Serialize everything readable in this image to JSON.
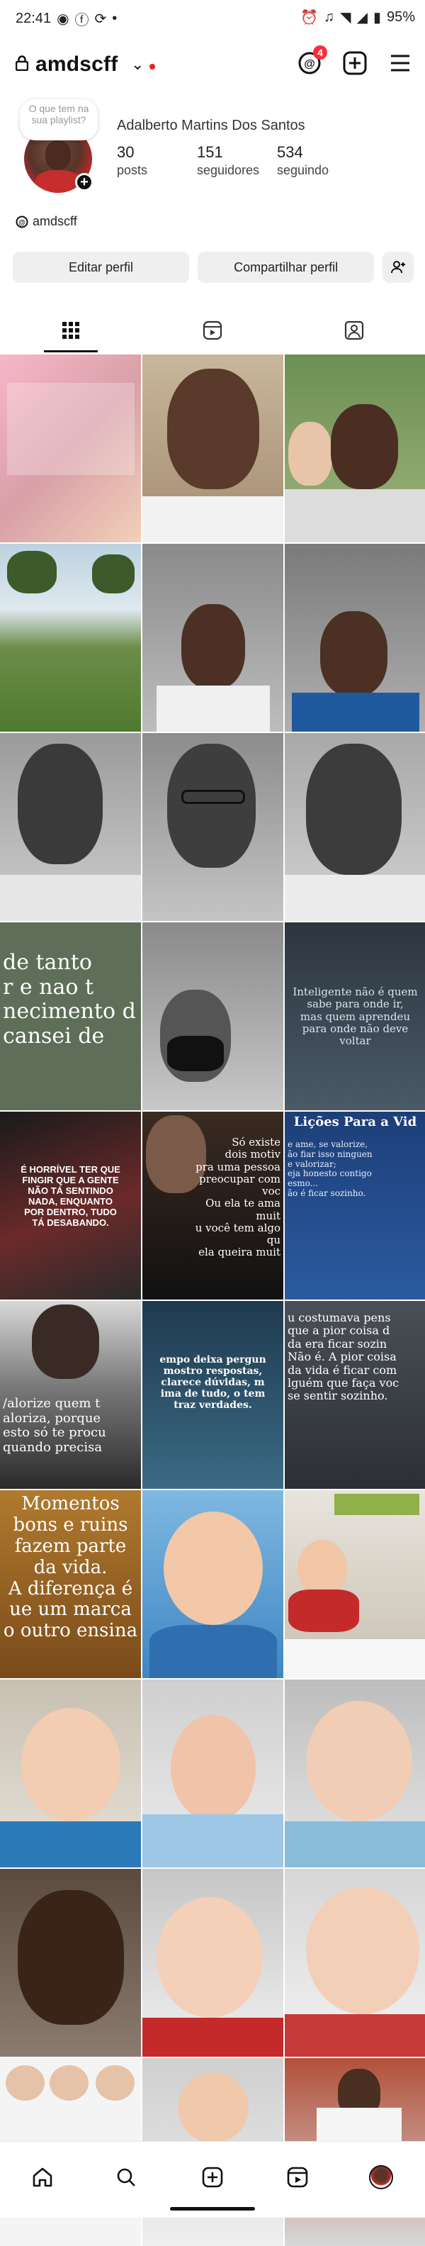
{
  "status_bar": {
    "time": "22:41",
    "battery": "95%"
  },
  "header": {
    "username": "amdscff",
    "notification_count": "4"
  },
  "profile": {
    "note": "O que tem na sua playlist?",
    "full_name": "Adalberto Martins Dos Santos",
    "stats": [
      {
        "value": "30",
        "label": "posts"
      },
      {
        "value": "151",
        "label": "seguidores"
      },
      {
        "value": "534",
        "label": "seguindo"
      }
    ],
    "threads_handle": "amdscff"
  },
  "actions": {
    "edit": "Editar perfil",
    "share": "Compartilhar perfil"
  },
  "tabs": [
    "posts-grid",
    "reels",
    "tagged"
  ],
  "grid": {
    "text_posts": {
      "p4": [
        "de tanto",
        "r e nao t",
        "necimento d",
        "cansei de"
      ],
      "p6": [
        "Inteligente não é quem",
        "sabe para onde ir,",
        "mas quem aprendeu",
        "para onde não deve voltar"
      ],
      "p7": [
        "É HORRÍVEL TER QUE",
        "FINGIR QUE A GENTE",
        "NÃO TÁ SENTINDO",
        "NADA, ENQUANTO",
        "POR DENTRO, TUDO",
        "TÁ DESABANDO."
      ],
      "p8": [
        "Só existe",
        "dois motiv",
        "pra uma pessoa",
        "preocupar com voc",
        "Ou ela te ama muit",
        "u você tem algo qu",
        "ela queira muit"
      ],
      "p9_title": "Lições Para a Vid",
      "p9": [
        "e ame, se valorize,",
        "ão fiar isso ninguen",
        "e valorizar;",
        "eja honesto contigo",
        "esmo...",
        "ão é ficar sozinho."
      ],
      "p10": [
        "/alorize quem t",
        "aloriza, porque",
        "esto só te procu",
        "quando precisa"
      ],
      "p11": [
        "empo deixa pergun",
        "mostro respostas,",
        "clarece dúvidas, m",
        "ima de tudo, o tem",
        "traz verdades."
      ],
      "p12": [
        "u costumava pens",
        "que a pior coisa d",
        "da era ficar sozin",
        "Não é. A pior coisa",
        "da vida é ficar com",
        "lguém que faça voc",
        "se sentir sozinho."
      ],
      "p13": [
        "Momentos",
        "bons e ruins",
        "fazem parte",
        "da vida.",
        "A diferença é",
        "ue um marca",
        "o outro ensina"
      ]
    }
  },
  "colors": {
    "accent_red": "#ff2b3d",
    "tab_active": "#111111"
  },
  "bottom_nav": [
    "home-icon",
    "search-icon",
    "create-icon",
    "reels-icon",
    "profile-avatar"
  ]
}
